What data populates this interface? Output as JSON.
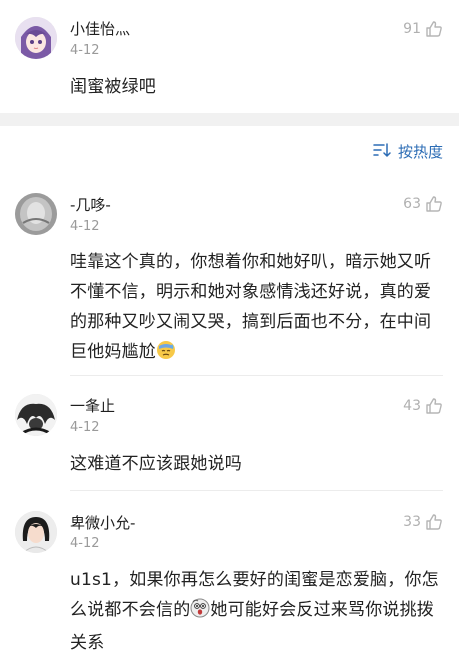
{
  "comments": [
    {
      "username": "小佳怡灬",
      "date": "4-12",
      "likes": "91",
      "text": "闺蜜被绿吧"
    },
    {
      "username": "-几哆-",
      "date": "4-12",
      "likes": "63",
      "text_part1": "哇靠这个真的，你想着你和她好叭，暗示她又听不懂不信，明示和她对象感情浅还好说，真的爱的那种又吵又闹又哭，搞到后面也不分，在中间巨他妈尴尬"
    },
    {
      "username": "一夆止",
      "date": "4-12",
      "likes": "43",
      "text": "这难道不应该跟她说吗"
    },
    {
      "username": "卑微小允-",
      "date": "4-12",
      "likes": "33",
      "text_part1": "u1s1，如果你再怎么要好的闺蜜是恋爱脑，你怎么说都不会信的",
      "text_part2": "她可能好会反过来骂你说挑拨关系"
    }
  ],
  "sort": {
    "label": "按热度",
    "icon": "sort-icon"
  },
  "icons": {
    "like": "thumbs-up-icon",
    "emoji_sweat": "sweat-emoji-icon",
    "emoji_shock": "shocked-emoji-icon"
  },
  "colors": {
    "accent": "#2d6db5",
    "meta": "#9a9a9a",
    "divider": "#ececec",
    "band": "#f1f1f1"
  }
}
